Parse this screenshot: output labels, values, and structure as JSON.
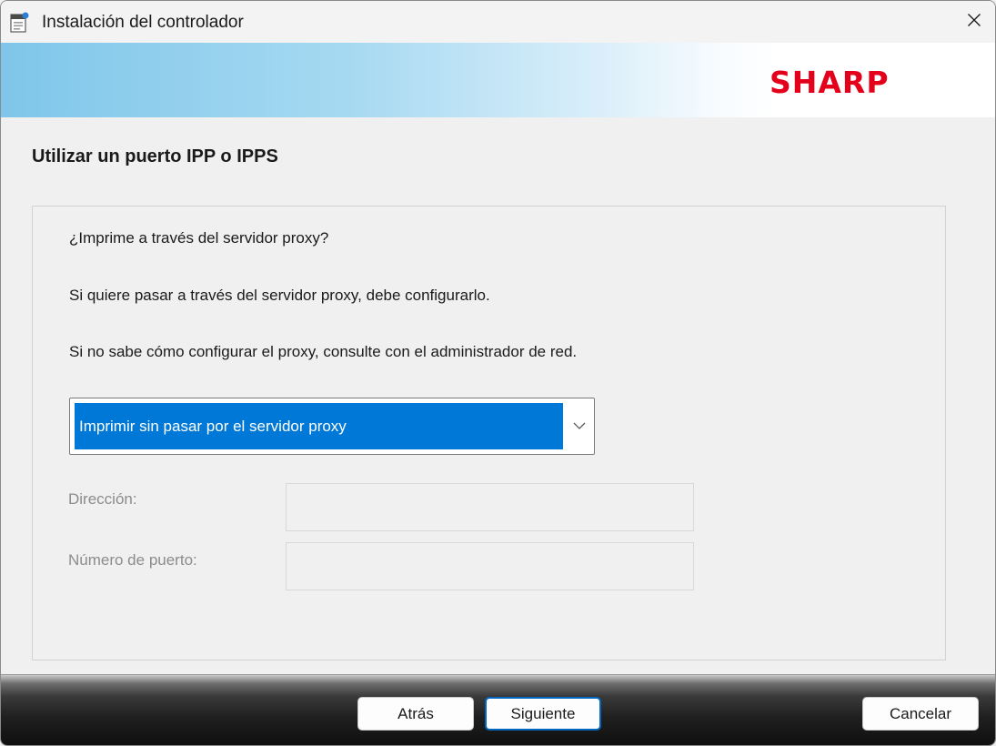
{
  "window": {
    "title": "Instalación del controlador",
    "close_icon": "close-icon",
    "app_icon": "printer-installer-icon"
  },
  "banner": {
    "logo_text": "SHARP",
    "logo_color": "#e4001b"
  },
  "page": {
    "title": "Utilizar un puerto IPP o IPPS",
    "question": "¿Imprime a través del servidor proxy?",
    "info_line_1": "Si quiere pasar a través del servidor proxy, debe configurarlo.",
    "info_line_2": "Si no sabe cómo configurar el proxy, consulte con el administrador de red."
  },
  "proxy_select": {
    "selected": "Imprimir sin pasar por el servidor proxy",
    "icon": "chevron-down-icon",
    "highlight_color": "#0078d7"
  },
  "fields": {
    "address_label": "Dirección:",
    "address_value": "",
    "port_label": "Número de puerto:",
    "port_value": ""
  },
  "buttons": {
    "back": "Atrás",
    "next": "Siguiente",
    "cancel": "Cancelar"
  }
}
